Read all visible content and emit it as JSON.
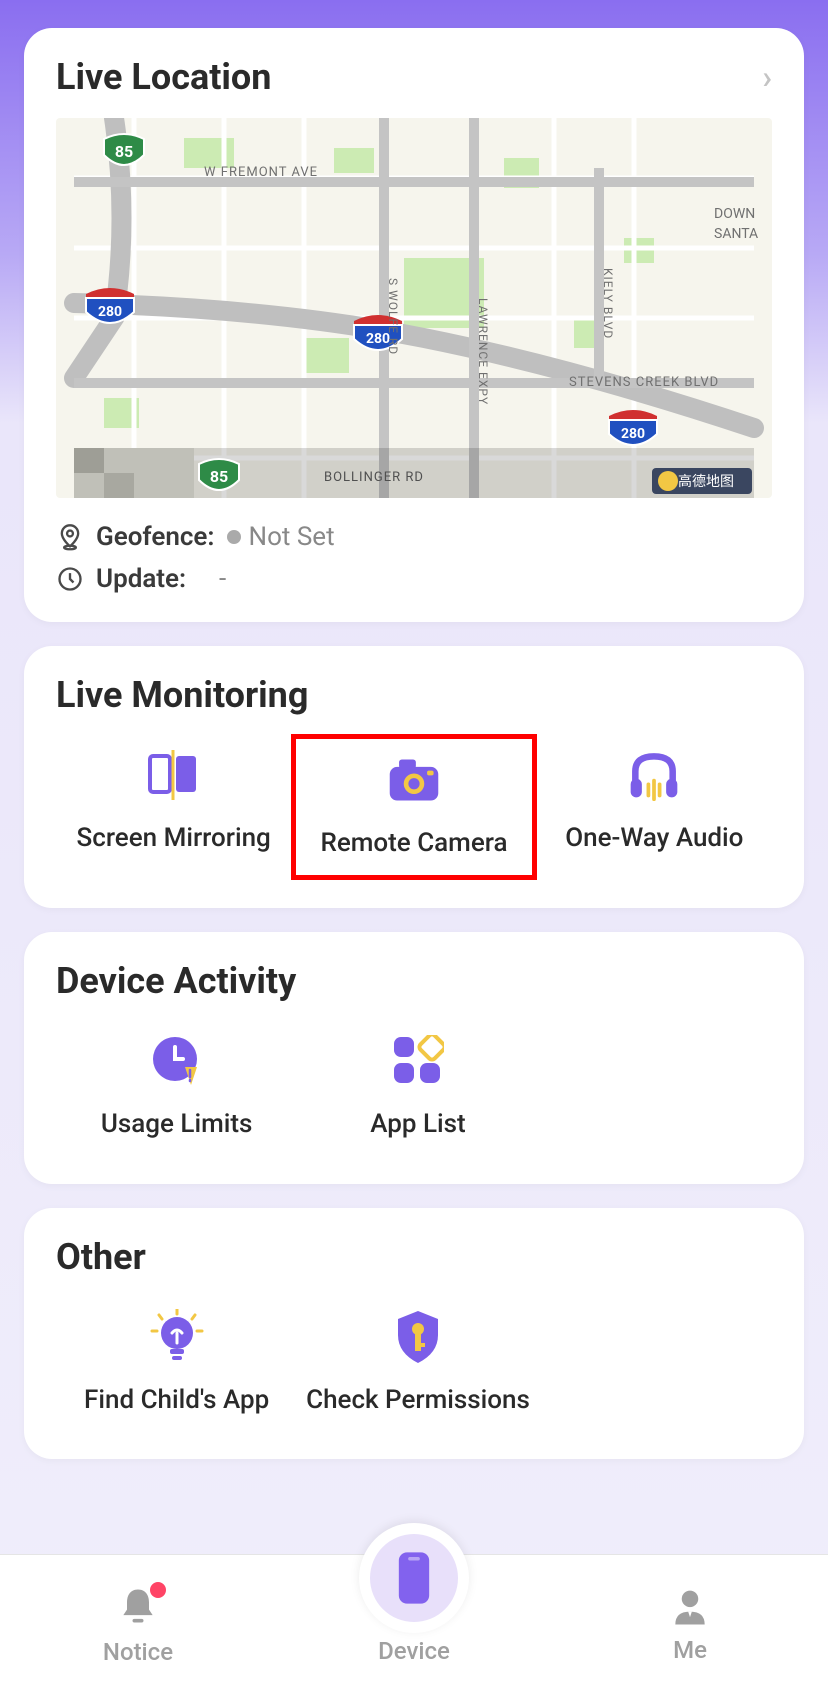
{
  "liveLocation": {
    "title": "Live Location",
    "geofence_label": "Geofence:",
    "geofence_value": "Not Set",
    "update_label": "Update:",
    "update_value": "-",
    "map": {
      "roads": [
        "W FREMONT AVE",
        "S WOLFE RD",
        "LAWRENCE EXPY",
        "KIELY BLVD",
        "STEVENS CREEK BLVD",
        "BOLLINGER RD"
      ],
      "areas": [
        "DOWN",
        "SANTA"
      ],
      "highway_shields": [
        "85",
        "280",
        "280",
        "85",
        "280"
      ],
      "attribution": "高德地图"
    }
  },
  "liveMonitoring": {
    "title": "Live Monitoring",
    "items": [
      {
        "label": "Screen Mirroring",
        "icon": "screen-mirror-icon",
        "highlighted": false
      },
      {
        "label": "Remote Camera",
        "icon": "camera-icon",
        "highlighted": true
      },
      {
        "label": "One-Way Audio",
        "icon": "headphones-icon",
        "highlighted": false
      }
    ]
  },
  "deviceActivity": {
    "title": "Device Activity",
    "items": [
      {
        "label": "Usage Limits",
        "icon": "clock-limit-icon"
      },
      {
        "label": "App List",
        "icon": "apps-icon"
      }
    ]
  },
  "other": {
    "title": "Other",
    "items": [
      {
        "label": "Find Child's App",
        "icon": "lightbulb-icon"
      },
      {
        "label": "Check Permissions",
        "icon": "shield-key-icon"
      }
    ]
  },
  "nav": {
    "items": [
      {
        "label": "Notice",
        "icon": "bell-icon",
        "badge": true
      },
      {
        "label": "Device",
        "icon": "phone-icon",
        "active": true
      },
      {
        "label": "Me",
        "icon": "person-icon"
      }
    ]
  },
  "colors": {
    "primary": "#7b5ee8",
    "accent": "#f2c744"
  }
}
